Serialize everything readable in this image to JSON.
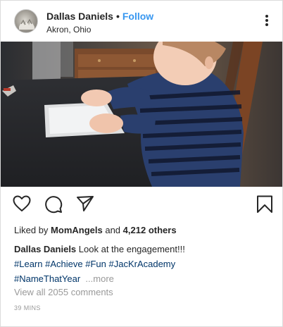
{
  "header": {
    "username": "Dallas Daniels",
    "separator": "•",
    "follow_label": "Follow",
    "location": "Akron, Ohio"
  },
  "icons": {
    "options": "more-vertical-icon",
    "like": "heart-icon",
    "comment": "comment-icon",
    "share": "send-icon",
    "save": "bookmark-icon"
  },
  "likes": {
    "prefix": "Liked by",
    "user": "MomAngels",
    "joiner": "and",
    "count_text": "4,212 others"
  },
  "caption": {
    "username": "Dallas Daniels",
    "text": "Look at the engagement!!!",
    "hashtags": [
      "#Learn",
      "#Achieve",
      "#Fun",
      "#JacKrAcademy",
      "#NameThatYear"
    ],
    "more_label": "...more"
  },
  "comments_link": "View all 2055 comments",
  "timestamp": "39 MINS",
  "colors": {
    "link_blue": "#3897f0",
    "hashtag": "#003569",
    "muted": "#999999",
    "text": "#262626"
  }
}
